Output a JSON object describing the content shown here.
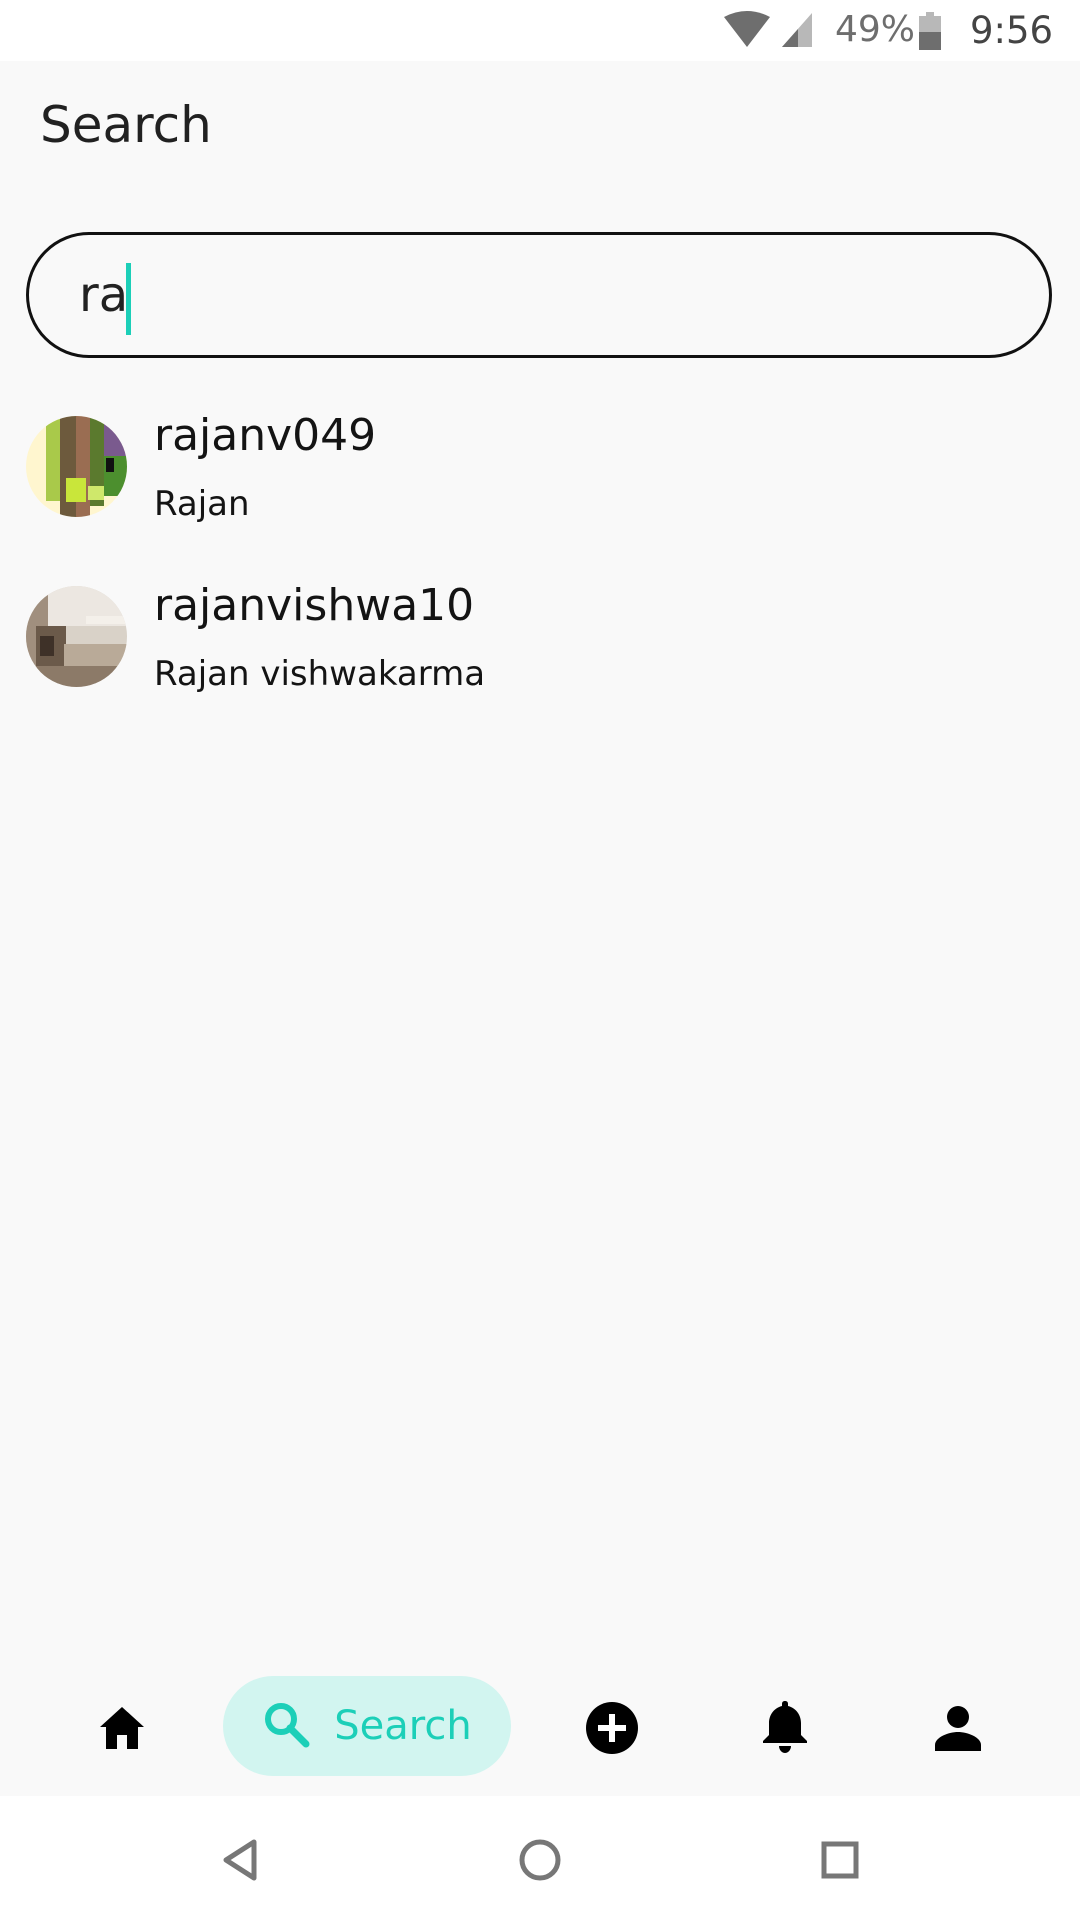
{
  "status_bar": {
    "battery_percent": "49%",
    "time": "9:56",
    "icons": [
      "wifi-icon",
      "cell-signal-icon",
      "battery-icon"
    ]
  },
  "page": {
    "title": "Search"
  },
  "search": {
    "value": "ra",
    "accent_color": "#1ccfb8"
  },
  "results": [
    {
      "username": "rajanv049",
      "full_name": "Rajan"
    },
    {
      "username": "rajanvishwa10",
      "full_name": "Rajan vishwakarma"
    }
  ],
  "bottom_nav": {
    "items": [
      {
        "icon": "home-icon"
      },
      {
        "icon": "search-icon",
        "label": "Search",
        "active": true
      },
      {
        "icon": "add-circle-icon"
      },
      {
        "icon": "bell-icon"
      },
      {
        "icon": "person-icon"
      }
    ],
    "active_background": "#d2f5f0",
    "active_color": "#1ccfb8"
  },
  "system_nav": {
    "icons": [
      "back-icon",
      "home-circle-icon",
      "recents-icon"
    ]
  }
}
